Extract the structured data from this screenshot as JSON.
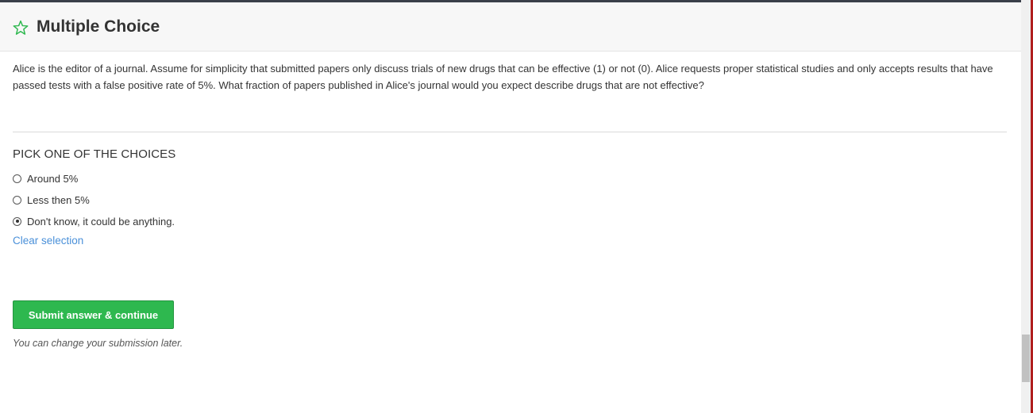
{
  "header": {
    "title": "Multiple Choice",
    "star_icon": "star-outline-icon",
    "accent_color": "#2eb84f"
  },
  "question": {
    "text": "Alice is the editor of a journal. Assume for simplicity that submitted papers only discuss trials of new drugs that can be effective (1) or not (0). Alice requests proper statistical studies and only accepts results that have passed tests with a false positive rate of 5%. What fraction of papers published in Alice's journal would you expect describe drugs that are not effective?"
  },
  "choices": {
    "heading": "PICK ONE OF THE CHOICES",
    "options": [
      {
        "label": "Around 5%",
        "selected": false
      },
      {
        "label": "Less then 5%",
        "selected": false
      },
      {
        "label": "Don't know, it could be anything.",
        "selected": true
      }
    ],
    "clear_label": "Clear selection"
  },
  "submit": {
    "label": "Submit answer & continue",
    "hint": "You can change your submission later."
  }
}
